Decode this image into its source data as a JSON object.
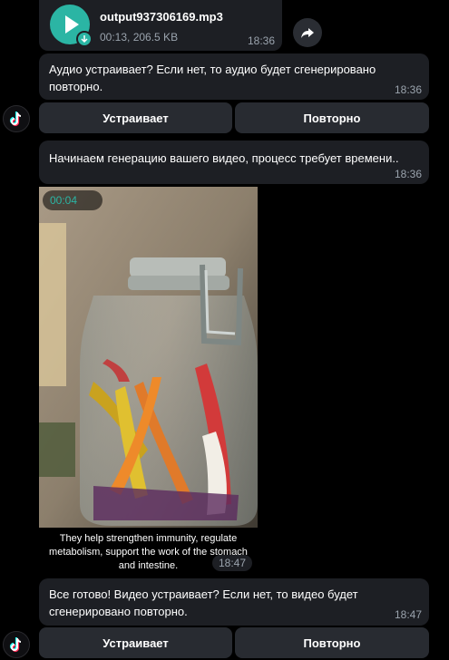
{
  "audio_message": {
    "file_name": "output937306169.mp3",
    "meta": "00:13, 206.5 KB",
    "time": "18:36"
  },
  "audio_prompt": {
    "text": "Аудио устраивает? Если нет, то аудио будет сгенерировано повторно.",
    "time": "18:36"
  },
  "audio_buttons": {
    "accept": "Устраивает",
    "retry": "Повторно"
  },
  "generation_message": {
    "text": "Начинаем генерацию вашего видео, процесс требует времени..",
    "time": "18:36"
  },
  "video_message": {
    "duration": "00:04",
    "caption": "They help strengthen immunity, regulate metabolism, support the work of the stomach and intestine.",
    "time": "18:47"
  },
  "video_prompt": {
    "text": "Все готово! Видео устраивает? Если нет, то видео будет сгенерировано повторно.",
    "time": "18:47"
  },
  "video_buttons": {
    "accept": "Устраивает",
    "retry": "Повторно"
  },
  "colors": {
    "background": "#000000",
    "bubble": "#1d1f24",
    "button": "#282b31",
    "accent": "#2bb5a4",
    "muted_text": "#9aa3ad"
  }
}
